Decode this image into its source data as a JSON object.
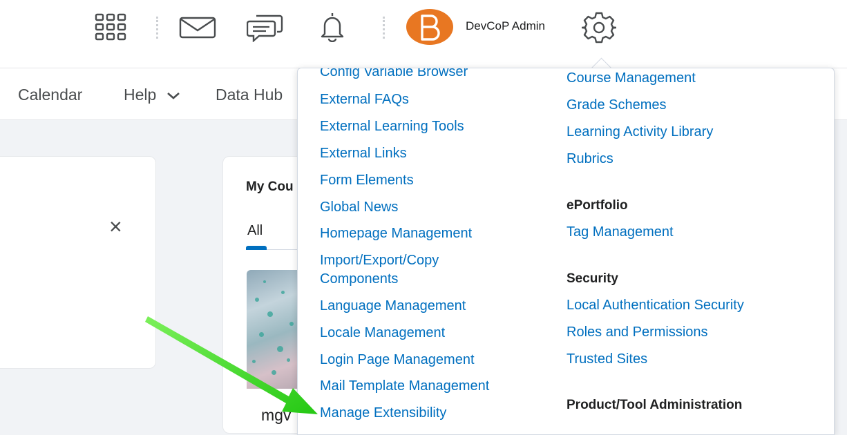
{
  "topbar": {
    "username": "DevCoP Admin",
    "avatar_letter": "B",
    "icons": [
      "apps-grid-icon",
      "mail-icon",
      "chat-icon",
      "bell-icon",
      "gear-icon"
    ]
  },
  "nav": {
    "items": [
      {
        "label": "Calendar"
      },
      {
        "label": "Help",
        "has_chevron": true
      },
      {
        "label": "Data Hub"
      }
    ]
  },
  "widget": {
    "close_label": "×"
  },
  "my_courses": {
    "title": "My Cou",
    "tab_all": "All",
    "course_name": "mgv"
  },
  "dropdown": {
    "left_links": [
      "Config Variable Browser",
      "External FAQs",
      "External Learning Tools",
      "External Links",
      "Form Elements",
      "Global News",
      "Homepage Management",
      "Import/Export/Copy",
      "Components",
      "Language Management",
      "Locale Management",
      "Login Page Management",
      "Mail Template Management",
      "Manage Extensibility"
    ],
    "right": {
      "top_links": [
        "Course Management",
        "Grade Schemes",
        "Learning Activity Library",
        "Rubrics"
      ],
      "eportfolio_heading": "ePortfolio",
      "eportfolio_links": [
        "Tag Management"
      ],
      "security_heading": "Security",
      "security_links": [
        "Local Authentication Security",
        "Roles and Permissions",
        "Trusted Sites"
      ],
      "product_heading": "Product/Tool Administration"
    }
  },
  "colors": {
    "link": "#006fbf",
    "accent_orange": "#e87722",
    "arrow_green": "#3ddc1e"
  }
}
